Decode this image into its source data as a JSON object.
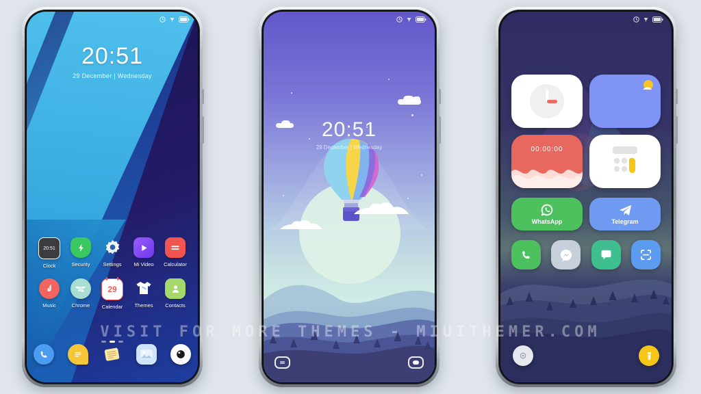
{
  "canvas": {
    "watermark": "VISIT FOR MORE THEMES - MIUITHEMER.COM",
    "background_color": "#dfe5eb"
  },
  "status_bar": {
    "icons": [
      "alarm-clock-icon",
      "silent-mode-icon",
      "battery-icon"
    ]
  },
  "phone1": {
    "name": "home-screen-blue-wallpaper",
    "lockscreen": {
      "time": "20:51",
      "date": "29 December | Wednesday"
    },
    "apps": [
      {
        "label": "Clock",
        "icon": "clock-widget-icon",
        "color": "#3c3c40",
        "glyph": "20:51"
      },
      {
        "label": "Security",
        "icon": "shield-bolt-icon",
        "color": "#3cc861",
        "glyph": "⚡"
      },
      {
        "label": "Settings",
        "icon": "gear-icon",
        "color": "#eef3f8",
        "glyph": "⚙"
      },
      {
        "label": "Mi Video",
        "icon": "play-triangle-icon",
        "color": "#8a4dff",
        "glyph": "▶"
      },
      {
        "label": "Calculator",
        "icon": "equals-icon",
        "color": "#f0554f",
        "glyph": "="
      },
      {
        "label": "Music",
        "icon": "music-note-icon",
        "color": "#f2655f",
        "glyph": "♪"
      },
      {
        "label": "Chrome",
        "icon": "chrome-icon",
        "color": "#a9ddd2",
        "glyph": ""
      },
      {
        "label": "Calendar",
        "icon": "calendar-29-icon",
        "color": "#ffffff",
        "glyph": "29"
      },
      {
        "label": "Themes",
        "icon": "t-shirt-icon",
        "color": "#ffffff",
        "glyph": ""
      },
      {
        "label": "Contacts",
        "icon": "person-icon",
        "color": "#a5d86a",
        "glyph": "●"
      }
    ],
    "page_dots": 3,
    "active_dot": 1,
    "dock": [
      {
        "icon": "phone-icon",
        "color": "#4a9df0"
      },
      {
        "icon": "messages-icon",
        "color": "#f5c638"
      },
      {
        "icon": "notes-icon",
        "color": "#f7e59a"
      },
      {
        "icon": "gallery-icon",
        "color": "#cfe3fa"
      },
      {
        "icon": "camera-icon",
        "color": "#ffffff"
      }
    ]
  },
  "phone2": {
    "name": "lockscreen-balloon-wallpaper",
    "time": "20:51",
    "date": "29 December | Wednesday",
    "nav": [
      {
        "icon": "menu-recents-icon"
      },
      {
        "icon": "home-pill-icon"
      }
    ]
  },
  "phone3": {
    "name": "home-screen-widgets-dark-wallpaper",
    "widgets": [
      {
        "name": "analog-clock-widget",
        "icon": "analog-clock-icon",
        "color": "#ffffff",
        "value": ""
      },
      {
        "name": "weather-widget",
        "icon": "sun-cloud-icon",
        "color": "#8094f5",
        "value": ""
      },
      {
        "name": "stopwatch-widget",
        "icon": "stopwatch-icon",
        "color": "#e8685f",
        "value": "00:00:00"
      },
      {
        "name": "calculator-widget",
        "icon": "calculator-icon",
        "color": "#ffffff",
        "value": ""
      }
    ],
    "apps": [
      {
        "label": "WhatsApp",
        "icon": "whatsapp-icon",
        "color": "#4cc15e"
      },
      {
        "label": "Telegram",
        "icon": "telegram-icon",
        "color": "#6e9af2"
      }
    ],
    "shortcuts": [
      {
        "icon": "phone-icon",
        "color": "#4cc15e"
      },
      {
        "icon": "messenger-icon",
        "color": "#c6cfda"
      },
      {
        "icon": "chat-bubble-icon",
        "color": "#3fbf8f"
      },
      {
        "icon": "scanner-icon",
        "color": "#5b9cf0"
      }
    ],
    "bottom": [
      {
        "icon": "camera-shutter-icon",
        "color": "#e6eaef"
      },
      {
        "icon": "flashlight-icon",
        "color": "#f5c518"
      }
    ]
  }
}
